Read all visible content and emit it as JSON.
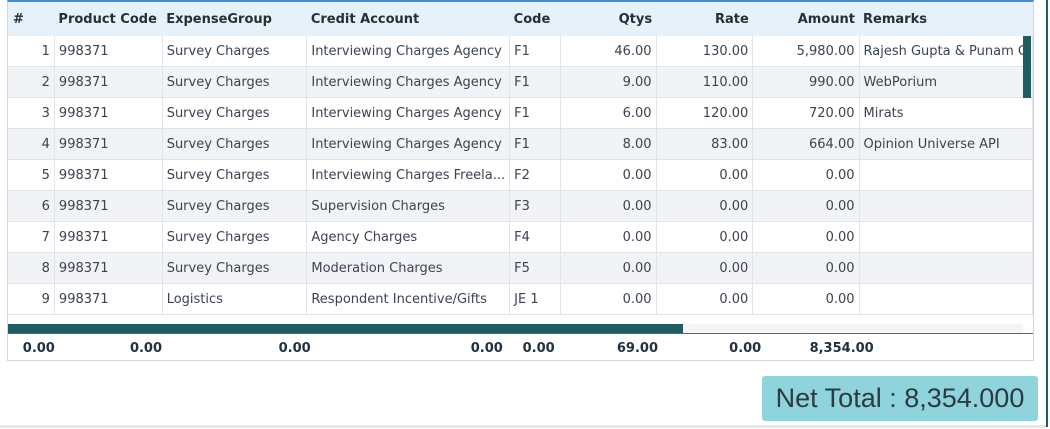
{
  "columns": {
    "num": "#",
    "product_code": "Product Code",
    "expense_group": "ExpenseGroup",
    "credit_account": "Credit Account",
    "code": "Code",
    "qtys": "Qtys",
    "rate": "Rate",
    "amount": "Amount",
    "remarks": "Remarks"
  },
  "rows": [
    {
      "num": "1",
      "product_code": "998371",
      "expense_group": "Survey Charges",
      "credit_account": "Interviewing Charges Agency",
      "code": "F1",
      "qtys": "46.00",
      "rate": "130.00",
      "amount": "5,980.00",
      "remarks": "Rajesh Gupta & Punam G"
    },
    {
      "num": "2",
      "product_code": "998371",
      "expense_group": "Survey Charges",
      "credit_account": "Interviewing Charges Agency",
      "code": "F1",
      "qtys": "9.00",
      "rate": "110.00",
      "amount": "990.00",
      "remarks": "WebPorium"
    },
    {
      "num": "3",
      "product_code": "998371",
      "expense_group": "Survey Charges",
      "credit_account": "Interviewing Charges Agency",
      "code": "F1",
      "qtys": "6.00",
      "rate": "120.00",
      "amount": "720.00",
      "remarks": "Mirats"
    },
    {
      "num": "4",
      "product_code": "998371",
      "expense_group": "Survey Charges",
      "credit_account": "Interviewing Charges Agency",
      "code": "F1",
      "qtys": "8.00",
      "rate": "83.00",
      "amount": "664.00",
      "remarks": "Opinion Universe API"
    },
    {
      "num": "5",
      "product_code": "998371",
      "expense_group": "Survey Charges",
      "credit_account": "Interviewing Charges Freela...",
      "code": "F2",
      "qtys": "0.00",
      "rate": "0.00",
      "amount": "0.00",
      "remarks": ""
    },
    {
      "num": "6",
      "product_code": "998371",
      "expense_group": "Survey Charges",
      "credit_account": "Supervision Charges",
      "code": "F3",
      "qtys": "0.00",
      "rate": "0.00",
      "amount": "0.00",
      "remarks": ""
    },
    {
      "num": "7",
      "product_code": "998371",
      "expense_group": "Survey Charges",
      "credit_account": "Agency Charges",
      "code": "F4",
      "qtys": "0.00",
      "rate": "0.00",
      "amount": "0.00",
      "remarks": ""
    },
    {
      "num": "8",
      "product_code": "998371",
      "expense_group": "Survey Charges",
      "credit_account": "Moderation Charges",
      "code": "F5",
      "qtys": "0.00",
      "rate": "0.00",
      "amount": "0.00",
      "remarks": ""
    },
    {
      "num": "9",
      "product_code": "998371",
      "expense_group": "Logistics",
      "credit_account": "Respondent Incentive/Gifts",
      "code": "JE 1",
      "qtys": "0.00",
      "rate": "0.00",
      "amount": "0.00",
      "remarks": ""
    }
  ],
  "totals": {
    "num": "0.00",
    "product_code": "0.00",
    "expense_group": "0.00",
    "credit_account": "0.00",
    "code": "0.00",
    "qtys": "69.00",
    "rate": "0.00",
    "amount": "8,354.00"
  },
  "net_total": "Net Total : 8,354.000",
  "colors": {
    "header_bg": "#e6f1fa",
    "accent": "#1f5d63",
    "net_total_bg": "#8fd3dc"
  }
}
